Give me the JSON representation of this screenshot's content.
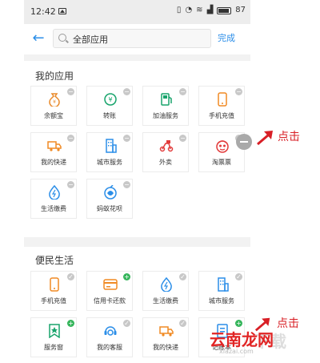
{
  "status_bar": {
    "time": "12:42",
    "battery": "87"
  },
  "search": {
    "back_label": "←",
    "text": "全部应用",
    "done_label": "完成"
  },
  "my_apps": {
    "title": "我的应用",
    "items": [
      {
        "label": "余额宝",
        "icon": "yuebao-icon",
        "color": "#e98a2a",
        "badge": "−"
      },
      {
        "label": "转账",
        "icon": "transfer-icon",
        "color": "#18a46c",
        "badge": "−"
      },
      {
        "label": "加油服务",
        "icon": "fuel-icon",
        "color": "#18a46c",
        "badge": "−"
      },
      {
        "label": "手机充值",
        "icon": "phone-recharge-icon",
        "color": "#f08a24",
        "badge": "−"
      },
      {
        "label": "我的快递",
        "icon": "truck-icon",
        "color": "#f08a24",
        "badge": "−"
      },
      {
        "label": "城市服务",
        "icon": "building-icon",
        "color": "#2b8ee8",
        "badge": "−"
      },
      {
        "label": "外卖",
        "icon": "scooter-icon",
        "color": "#e23b3b",
        "badge": "−"
      },
      {
        "label": "淘票票",
        "icon": "face-icon",
        "color": "#e23b3b",
        "badge": "−"
      },
      {
        "label": "生活缴费",
        "icon": "drop-icon",
        "color": "#2b8ee8",
        "badge": "−"
      },
      {
        "label": "蚂蚁花呗",
        "icon": "huabei-icon",
        "color": "#2b8ee8",
        "badge": "−"
      }
    ]
  },
  "convenience": {
    "title": "便民生活",
    "items": [
      {
        "label": "手机充值",
        "icon": "phone-recharge-icon",
        "color": "#f08a24",
        "badge": "✓"
      },
      {
        "label": "信用卡还款",
        "icon": "card-icon",
        "color": "#f08a24",
        "badge": "+"
      },
      {
        "label": "生活缴费",
        "icon": "drop-icon",
        "color": "#2b8ee8",
        "badge": "✓"
      },
      {
        "label": "城市服务",
        "icon": "building-icon",
        "color": "#2b8ee8",
        "badge": "✓"
      },
      {
        "label": "服务窗",
        "icon": "service-window-icon",
        "color": "#18a46c",
        "badge": "+"
      },
      {
        "label": "我的客服",
        "icon": "headset-icon",
        "color": "#2b8ee8",
        "badge": "✓"
      },
      {
        "label": "我的快递",
        "icon": "truck-icon",
        "color": "#f08a24",
        "badge": "✓"
      },
      {
        "label": "记账本",
        "icon": "ledger-icon",
        "color": "#2b8ee8",
        "badge": "+"
      }
    ]
  },
  "annotations": {
    "click_label_1": "点击",
    "click_label_2": "点击",
    "accent": "#d81f26"
  },
  "watermark": {
    "main": "云南龙网",
    "sub": "xiazai.com",
    "ghost": "下载"
  }
}
